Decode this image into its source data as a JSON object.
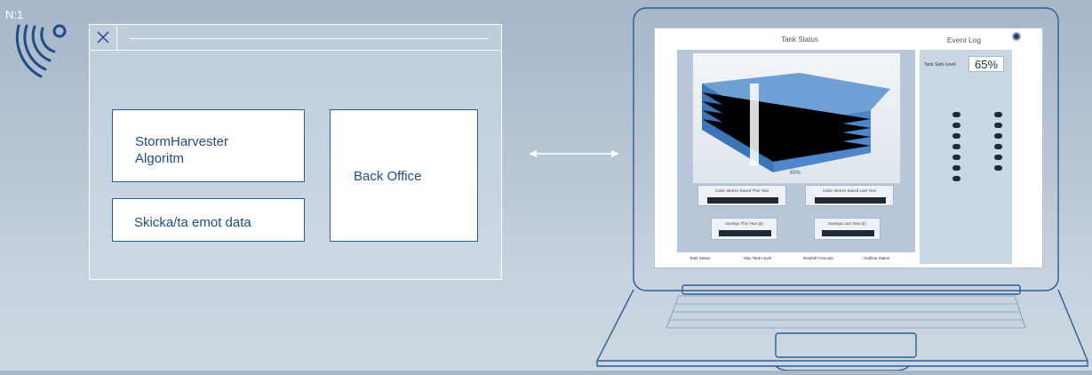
{
  "corner_label": "N:1",
  "icons": {
    "signal": "wireless-signal-icon",
    "close": "close-icon",
    "arrow": "double-arrow-icon",
    "gear": "gear-icon"
  },
  "diagram": {
    "algorithm_box": "StormHarvester\nAlgoritm",
    "send_box": "Skicka/ta emot data",
    "back_office_box": "Back Office"
  },
  "laptop_screen": {
    "tank_status_title": "Tank Status",
    "event_log_title": "Event Log",
    "tank_level_label": "Tank Safe Level",
    "tank_level_value": "65%",
    "tank_percent_small": "65%",
    "stats": [
      "Cubic Metres Saved This Year",
      "Cubic Metres Saved Last Year",
      "Savings This Year (£)",
      "Savings Last Year (£)"
    ],
    "tabs": [
      "Tank Status",
      "Max Tank Level",
      "Rainfall Forecast",
      "Outflow Status"
    ]
  },
  "colors": {
    "brand_blue": "#1f4d86",
    "line_white": "#ffffff"
  }
}
